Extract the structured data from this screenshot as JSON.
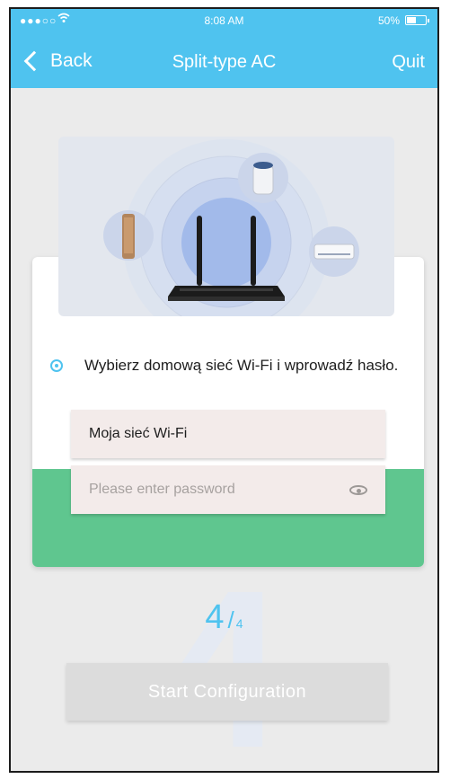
{
  "status_bar": {
    "signal_dots": "●●●○○",
    "wifi_icon": "wifi-icon",
    "time": "8:08 AM",
    "battery_percent": "50%",
    "battery_level": 0.5
  },
  "nav": {
    "back_label": "Back",
    "title": "Split-type AC",
    "quit_label": "Quit"
  },
  "illustration": {
    "icons": [
      "router-icon",
      "speaker-icon",
      "cylinder-device-icon",
      "ac-unit-icon"
    ]
  },
  "form": {
    "instruction": "Wybierz domową sieć Wi-Fi i wprowadź hasło.",
    "ssid_value": "Moja sieć Wi-Fi",
    "password_placeholder": "Please enter password"
  },
  "step": {
    "current": "4",
    "separator": "/",
    "total": "4"
  },
  "start_button_label": "Start Configuration",
  "colors": {
    "accent": "#4fc3ef",
    "green_panel": "#5fc68f",
    "button_disabled": "#dcdcdc"
  }
}
